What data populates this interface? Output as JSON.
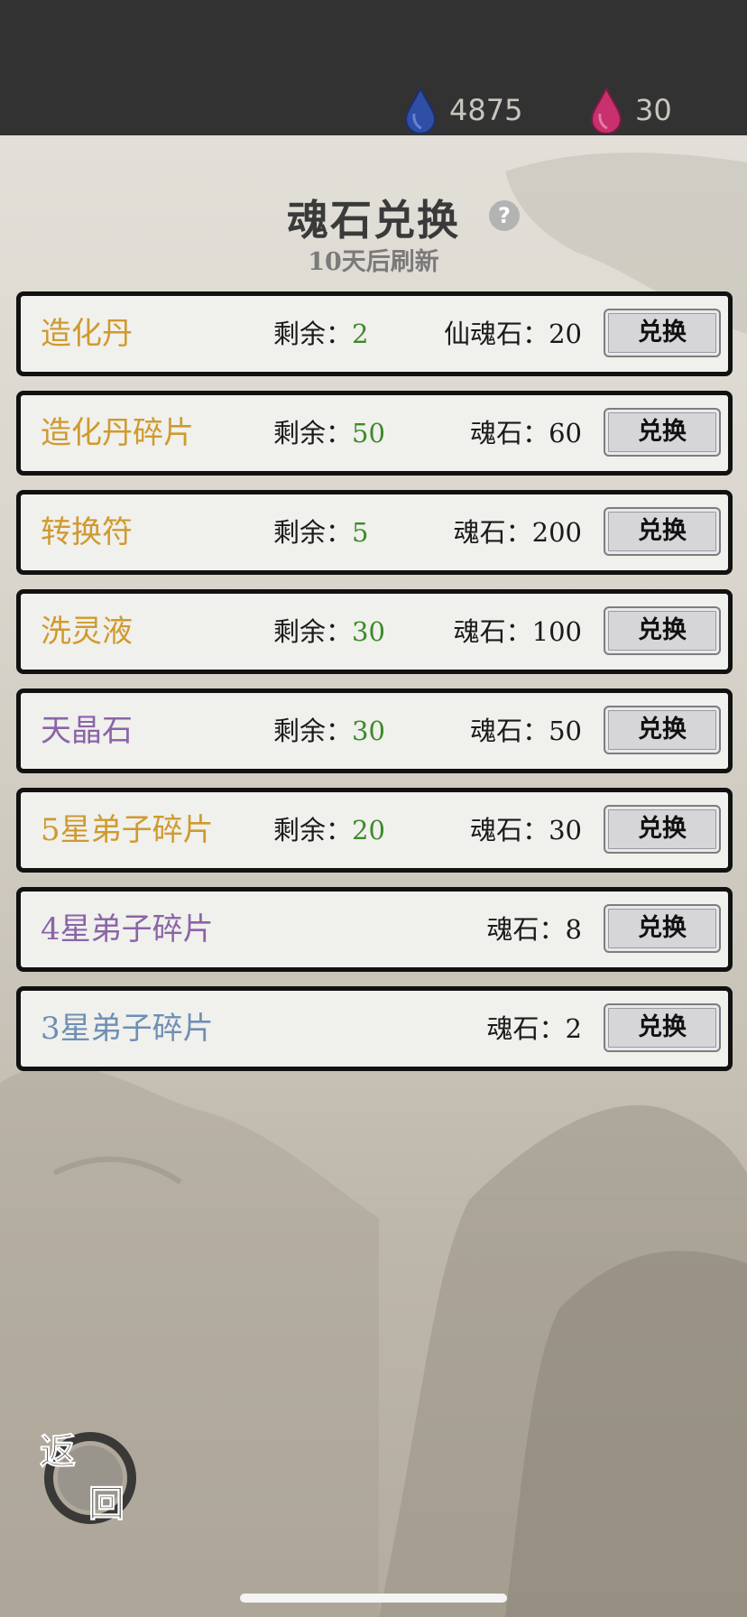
{
  "currency": [
    {
      "icon": "blue-soulstone-icon",
      "value": "4875",
      "color": "#2b4a99"
    },
    {
      "icon": "pink-soulstone-icon",
      "value": "30",
      "color": "#c4306c"
    }
  ],
  "header": {
    "title": "魂石兑换",
    "subtitle": "10天后刷新",
    "help": "?"
  },
  "labels": {
    "remain": "剩余：",
    "exchange": "兑换"
  },
  "items": [
    {
      "name": "造化丹",
      "color": "gold",
      "remain": "2",
      "price_label": "仙魂石：",
      "price": "20"
    },
    {
      "name": "造化丹碎片",
      "color": "gold",
      "remain": "50",
      "price_label": "魂石：",
      "price": "60"
    },
    {
      "name": "转换符",
      "color": "gold",
      "remain": "5",
      "price_label": "魂石：",
      "price": "200"
    },
    {
      "name": "洗灵液",
      "color": "gold",
      "remain": "30",
      "price_label": "魂石：",
      "price": "100"
    },
    {
      "name": "天晶石",
      "color": "purple",
      "remain": "30",
      "price_label": "魂石：",
      "price": "50"
    },
    {
      "name": "5星弟子碎片",
      "color": "gold",
      "remain": "20",
      "price_label": "魂石：",
      "price": "30"
    },
    {
      "name": "4星弟子碎片",
      "color": "purple",
      "remain": "",
      "price_label": "魂石：",
      "price": "8"
    },
    {
      "name": "3星弟子碎片",
      "color": "blue",
      "remain": "",
      "price_label": "魂石：",
      "price": "2"
    }
  ],
  "back_button": {
    "line1": "返",
    "line2": "回"
  }
}
